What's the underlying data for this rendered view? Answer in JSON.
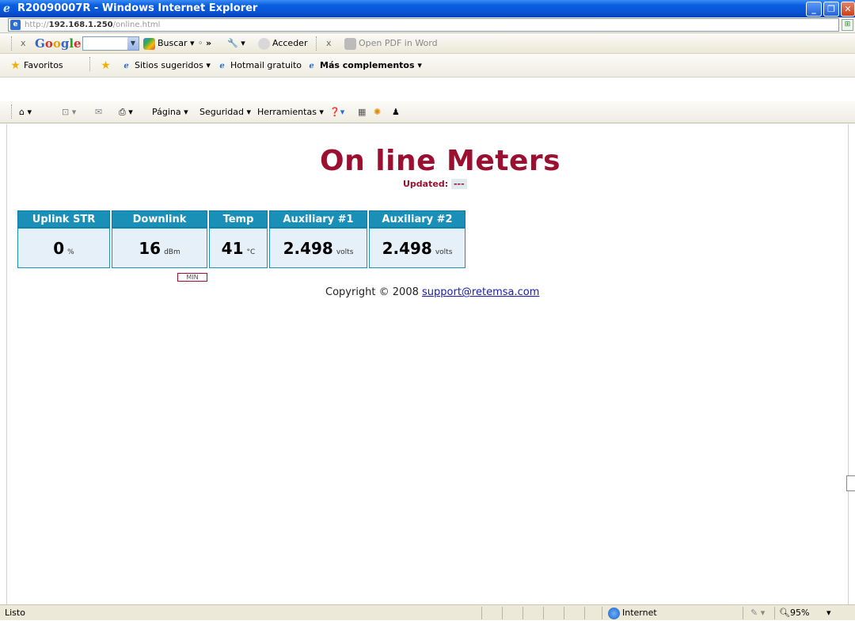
{
  "window": {
    "title": "R20090007R - Windows Internet Explorer",
    "minimize": "_",
    "maximize": "❐",
    "close": "✕"
  },
  "address": {
    "prefix": "http://",
    "host": "192.168.1.250",
    "path": "/online.html"
  },
  "google_bar": {
    "close": "x",
    "logo": "Google",
    "search_value": "",
    "search_label": "Buscar",
    "more": "»",
    "signin": "Acceder",
    "close2": "x",
    "pdf": "Open PDF in Word"
  },
  "favorites_bar": {
    "favorites": "Favoritos",
    "suggested": "Sitios sugeridos",
    "hotmail": "Hotmail gratuito",
    "more_addons": "Más complementos"
  },
  "command_bar": {
    "page": "Página",
    "security": "Seguridad",
    "tools": "Herramientas"
  },
  "page": {
    "heading": "On line Meters",
    "updated_label": "Updated:",
    "updated_value": "---",
    "meters": [
      {
        "label": "Uplink STR",
        "value": "0",
        "unit": "%"
      },
      {
        "label": "Downlink",
        "value": "16",
        "unit": "dBm"
      },
      {
        "label": "Temp",
        "value": "41",
        "unit": "°C"
      },
      {
        "label": "Auxiliary #1",
        "value": "2.498",
        "unit": "volts"
      },
      {
        "label": "Auxiliary #2",
        "value": "2.498",
        "unit": "volts"
      }
    ],
    "min_label": "MIN",
    "copyright": "Copyright © 2008",
    "support_link": "support@retemsa.com"
  },
  "statusbar": {
    "text": "Listo",
    "zone": "Internet",
    "zoom": "95%"
  },
  "colors": {
    "heading": "#9b1030",
    "table_header": "#1a90b8",
    "cell_bg": "#e6f0f8"
  }
}
